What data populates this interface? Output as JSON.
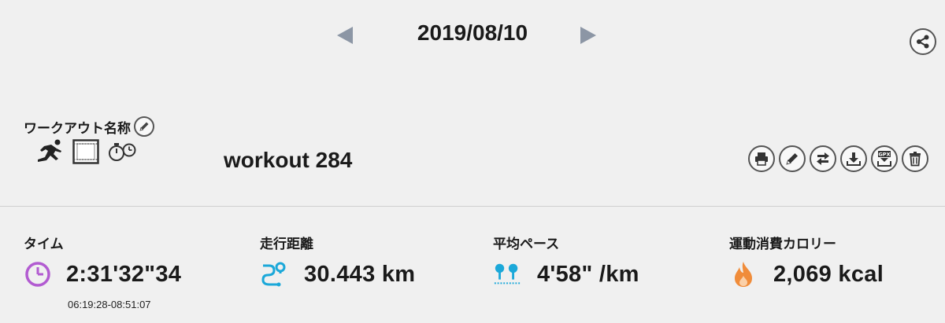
{
  "header": {
    "date": "2019/08/10",
    "prev_icon": "triangle-left-icon",
    "next_icon": "triangle-right-icon",
    "share_icon": "share-icon"
  },
  "workout": {
    "name_label": "ワークアウト名称",
    "name": "workout 284",
    "type_icons": [
      "runner-icon",
      "treadmill-icon",
      "stopwatch-icon"
    ]
  },
  "tools": [
    "print-icon",
    "edit-icon",
    "swap-icon",
    "download-icon",
    "gpx-download-icon",
    "trash-icon"
  ],
  "stats": {
    "time": {
      "label": "タイム",
      "value": "2:31'32\"34",
      "range": "06:19:28-08:51:07",
      "color": "#b25bd1"
    },
    "distance": {
      "label": "走行距離",
      "value": "30.443 km",
      "color": "#1ba8d9"
    },
    "pace": {
      "label": "平均ペース",
      "value": "4'58\" /km",
      "color": "#1ba8d9"
    },
    "calories": {
      "label": "運動消費カロリー",
      "value": "2,069 kcal",
      "color": "#f08c3a"
    }
  },
  "colors": {
    "background": "#f0f0f0",
    "arrow": "#8c96a5",
    "icon_border": "#555555"
  }
}
